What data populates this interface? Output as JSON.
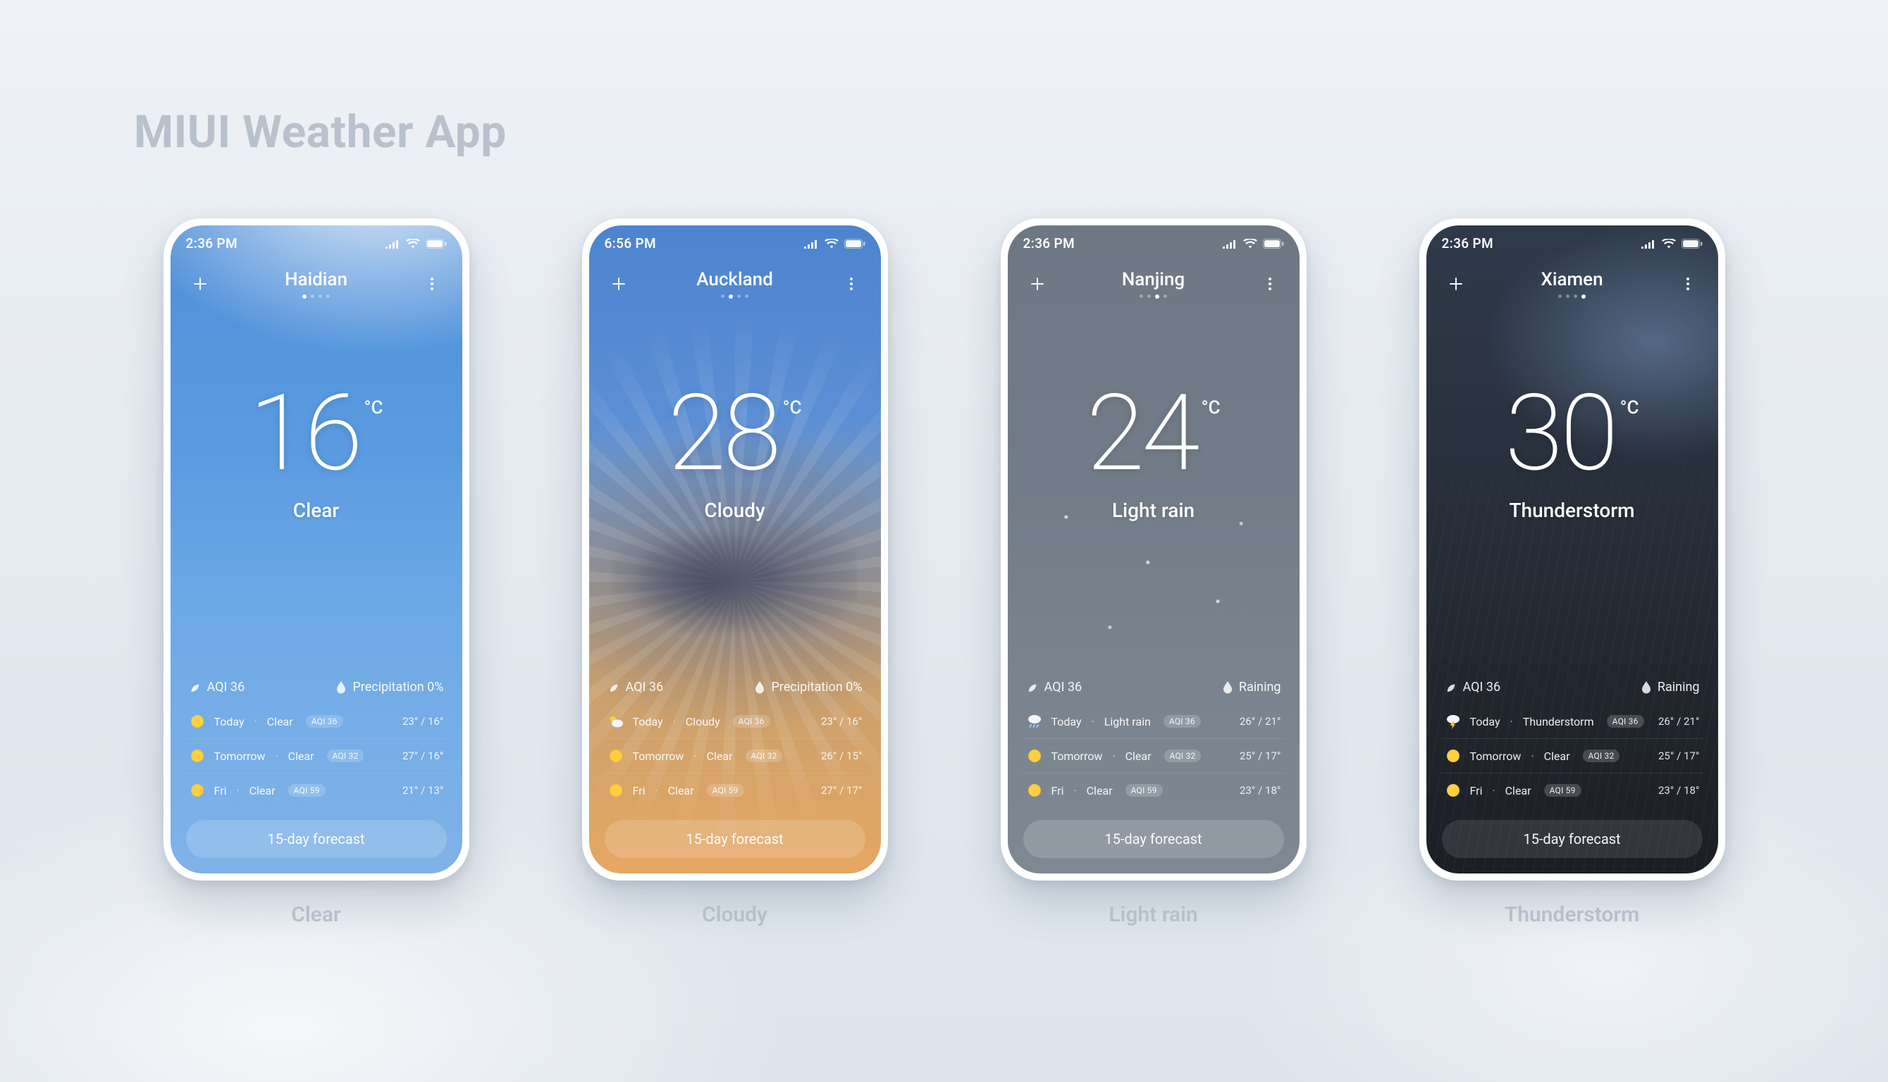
{
  "page_title": "MIUI Weather App",
  "unit": "°C",
  "forecast_button": "15-day forecast",
  "captions": [
    "Clear",
    "Cloudy",
    "Light rain",
    "Thunderstorm"
  ],
  "screens": [
    {
      "time": "2:36 PM",
      "city": "Haidian",
      "temp": "16",
      "condition": "Clear",
      "aqi_label": "AQI 36",
      "precip_label": "Precipitation 0%",
      "precip_icon": "drop",
      "forecast": [
        {
          "icon": "sun",
          "day": "Today",
          "cond": "Clear",
          "aqi": "AQI 36",
          "temps": "23° / 16°"
        },
        {
          "icon": "sun",
          "day": "Tomorrow",
          "cond": "Clear",
          "aqi": "AQI 32",
          "temps": "27° / 16°"
        },
        {
          "icon": "sun",
          "day": "Fri",
          "cond": "Clear",
          "aqi": "AQI 59",
          "temps": "21° / 13°"
        }
      ]
    },
    {
      "time": "6:56 PM",
      "city": "Auckland",
      "temp": "28",
      "condition": "Cloudy",
      "aqi_label": "AQI 36",
      "precip_label": "Precipitation 0%",
      "precip_icon": "drop",
      "forecast": [
        {
          "icon": "cloud-sun",
          "day": "Today",
          "cond": "Cloudy",
          "aqi": "AQI 36",
          "temps": "23° / 16°"
        },
        {
          "icon": "sun",
          "day": "Tomorrow",
          "cond": "Clear",
          "aqi": "AQI 32",
          "temps": "26° / 15°"
        },
        {
          "icon": "sun",
          "day": "Fri",
          "cond": "Clear",
          "aqi": "AQI 59",
          "temps": "27° / 17°"
        }
      ]
    },
    {
      "time": "2:36 PM",
      "city": "Nanjing",
      "temp": "24",
      "condition": "Light rain",
      "aqi_label": "AQI 36",
      "precip_label": "Raining",
      "precip_icon": "drop",
      "forecast": [
        {
          "icon": "rain",
          "day": "Today",
          "cond": "Light rain",
          "aqi": "AQI 36",
          "temps": "26° / 21°"
        },
        {
          "icon": "sun",
          "day": "Tomorrow",
          "cond": "Clear",
          "aqi": "AQI 32",
          "temps": "25° / 17°"
        },
        {
          "icon": "sun",
          "day": "Fri",
          "cond": "Clear",
          "aqi": "AQI 59",
          "temps": "23° / 18°"
        }
      ]
    },
    {
      "time": "2:36 PM",
      "city": "Xiamen",
      "temp": "30",
      "condition": "Thunderstorm",
      "aqi_label": "AQI 36",
      "precip_label": "Raining",
      "precip_icon": "drop",
      "forecast": [
        {
          "icon": "thunder",
          "day": "Today",
          "cond": "Thunderstorm",
          "aqi": "AQI 36",
          "temps": "26° / 21°"
        },
        {
          "icon": "sun",
          "day": "Tomorrow",
          "cond": "Clear",
          "aqi": "AQI 32",
          "temps": "25° / 17°"
        },
        {
          "icon": "sun",
          "day": "Fri",
          "cond": "Clear",
          "aqi": "AQI 59",
          "temps": "23° / 18°"
        }
      ]
    }
  ]
}
